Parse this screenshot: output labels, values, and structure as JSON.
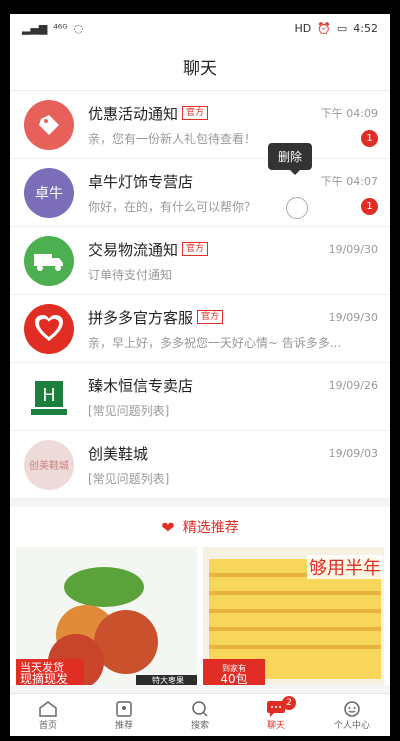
{
  "status": {
    "carrier": "⁴⁶ᴳ",
    "time": "4:52"
  },
  "nav": {
    "title": "聊天"
  },
  "conversations": [
    {
      "name": "优惠活动通知",
      "tag": "官方",
      "time": "下午 04:09",
      "message": "亲，您有一份新人礼包待查看！",
      "badge": "1"
    },
    {
      "name": "卓牛灯饰专营店",
      "tag": "",
      "time": "下午 04:07",
      "message": "你好，在的，有什么可以帮你？",
      "badge": "1",
      "avatar_text": "卓牛"
    },
    {
      "name": "交易物流通知",
      "tag": "官方",
      "time": "19/09/30",
      "message": "订单待支付通知",
      "badge": ""
    },
    {
      "name": "拼多多官方客服",
      "tag": "官方",
      "time": "19/09/30",
      "message": "亲，早上好，多多祝您一天好心情~ 告诉多多...",
      "badge": ""
    },
    {
      "name": "臻木恒信专卖店",
      "tag": "",
      "time": "19/09/26",
      "message": "[常见问题列表]",
      "badge": ""
    },
    {
      "name": "创美鞋城",
      "tag": "",
      "time": "19/09/03",
      "message": "[常见问题列表]",
      "badge": "",
      "avatar_text": "创美鞋城"
    }
  ],
  "tooltip": {
    "label": "删除"
  },
  "recommend": {
    "label": "精选推荐"
  },
  "products": [
    {
      "corner_label_1": "当天发货",
      "corner_label_2": "现摘现发",
      "bottom_label": "特大枣果"
    },
    {
      "corner_label": "够用半年",
      "bottom_label_1": "到家有",
      "bottom_label_2": "40包"
    }
  ],
  "tabbar": {
    "items": [
      {
        "label": "首页"
      },
      {
        "label": "推荐"
      },
      {
        "label": "搜索"
      },
      {
        "label": "聊天",
        "badge": "2"
      },
      {
        "label": "个人中心"
      }
    ]
  }
}
